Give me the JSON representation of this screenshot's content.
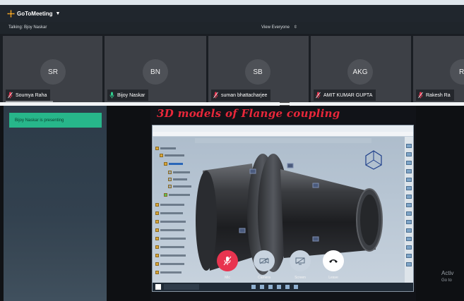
{
  "app": {
    "title": "GoToMeeting"
  },
  "subbar": {
    "talking": "Talking: Bjoy Naskar",
    "view_select": "View Everyone"
  },
  "participants": [
    {
      "initials": "SR",
      "name": "Soumya Raha",
      "mic": "muted"
    },
    {
      "initials": "BN",
      "name": "Bijoy Naskar",
      "mic": "active"
    },
    {
      "initials": "SB",
      "name": "suman bhattacharjee",
      "mic": "muted"
    },
    {
      "initials": "AKG",
      "name": "AMIT KUMAR GUPTA",
      "mic": "muted"
    },
    {
      "initials": "RI",
      "name": "Rakesh Ra",
      "mic": "muted"
    }
  ],
  "presenting": {
    "label": "Bijoy Naskar is presenting"
  },
  "slide": {
    "title": "3D models of Flange coupling"
  },
  "controls": [
    {
      "label": "Mic",
      "state": "muted",
      "color": "#e8344f"
    },
    {
      "label": "Camera",
      "state": "off",
      "color": "#c8d3df"
    },
    {
      "label": "Screen",
      "state": "off",
      "color": "#c8d3df"
    },
    {
      "label": "Leave",
      "state": "normal",
      "color": "#ffffff"
    }
  ],
  "watermark": {
    "line1": "Activ",
    "line2": "Go to"
  },
  "colors": {
    "accent": "#27b68a",
    "mic_muted": "#e8344f",
    "mic_active": "#2fcf8f",
    "title_red": "#e8273a"
  }
}
